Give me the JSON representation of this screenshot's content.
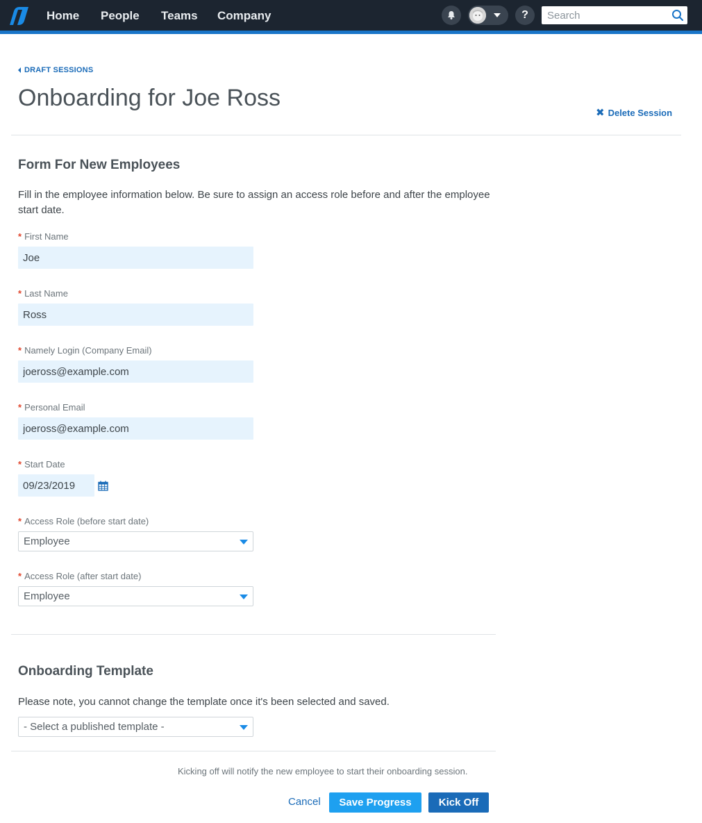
{
  "nav": {
    "items": [
      "Home",
      "People",
      "Teams",
      "Company"
    ],
    "search_placeholder": "Search",
    "help_label": "?"
  },
  "breadcrumb": {
    "label": "DRAFT SESSIONS"
  },
  "header": {
    "title": "Onboarding for Joe Ross",
    "delete_label": "Delete Session"
  },
  "form": {
    "title": "Form For New Employees",
    "description": "Fill in the employee information below. Be sure to assign an access role before and after the employee start date.",
    "required_marker": "*",
    "fields": {
      "first_name": {
        "label": "First Name",
        "value": "Joe"
      },
      "last_name": {
        "label": "Last Name",
        "value": "Ross"
      },
      "login": {
        "label": "Namely Login (Company Email)",
        "value": "joeross@example.com"
      },
      "personal_email": {
        "label": "Personal Email",
        "value": "joeross@example.com"
      },
      "start_date": {
        "label": "Start Date",
        "value": "09/23/2019"
      },
      "role_before": {
        "label": "Access Role (before start date)",
        "value": "Employee"
      },
      "role_after": {
        "label": "Access Role (after start date)",
        "value": "Employee"
      }
    }
  },
  "template": {
    "title": "Onboarding Template",
    "description": "Please note, you cannot change the template once it's been selected and saved.",
    "select_value": "- Select a published template -"
  },
  "footer": {
    "note": "Kicking off will notify the new employee to start their onboarding session.",
    "cancel_label": "Cancel",
    "save_label": "Save Progress",
    "kickoff_label": "Kick Off"
  },
  "colors": {
    "topbar": "#1c2530",
    "accent_stripe": "#1a75c8",
    "link": "#1a6bb8",
    "required": "#e0462d",
    "input_bg": "#e6f3fd",
    "save_button": "#1ea0f0",
    "kickoff_button": "#1a6bb8"
  }
}
